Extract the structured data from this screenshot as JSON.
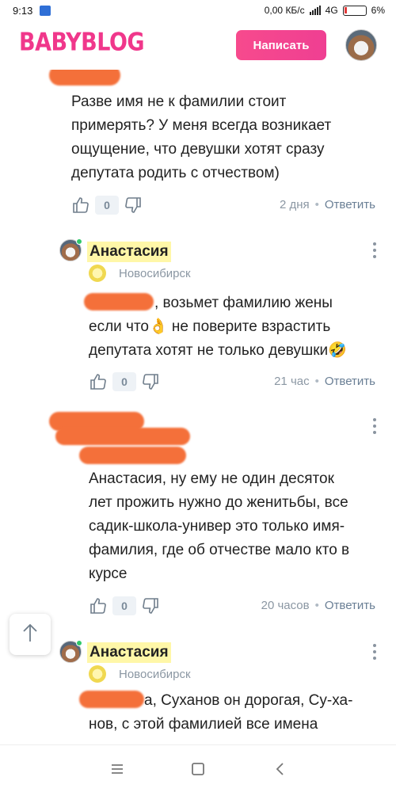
{
  "statusbar": {
    "time": "9:13",
    "network_speed": "0,00 КБ/с",
    "network_type": "4G",
    "battery": "6%"
  },
  "header": {
    "logo": "BABYBLOG",
    "write_button": "Написать"
  },
  "comments": [
    {
      "text_lines": [
        "Разве имя не к фамилии стоит",
        "примерять? У меня всегда возникает",
        "ощущение, что девушки хотят сразу",
        "депутата родить с отчеством)"
      ],
      "likes": "0",
      "time": "2 дня",
      "reply": "Ответить"
    },
    {
      "author": "Анастасия",
      "city": "Новосибирск",
      "text_lines": [
        ", возьмет фамилию жены",
        "если что👌 не поверите взрастить",
        "депутата хотят не только девушки🤣"
      ],
      "likes": "0",
      "time": "21 час",
      "reply": "Ответить"
    },
    {
      "text_lines": [
        "Анастасия, ну ему не один десяток",
        "лет прожить нужно до женитьбы, все",
        "садик-школа-универ это только имя-",
        "фамилия, где об отчестве мало кто в",
        "курсе"
      ],
      "likes": "0",
      "time": "20 часов",
      "reply": "Ответить"
    },
    {
      "author": "Анастасия",
      "city": "Новосибирск",
      "text_lines": [
        "а, Суханов он дорогая, Су-ха-",
        "нов, с этой фамилией все имена"
      ]
    }
  ],
  "colors": {
    "brand": "#f0378b",
    "redaction": "#f4703a",
    "highlight": "#fff7a8",
    "online": "#2fc86a"
  },
  "icons": [
    "thumbs-up-icon",
    "thumbs-down-icon",
    "kebab-icon",
    "location-icon",
    "arrow-up-icon",
    "menu-icon",
    "home-icon",
    "back-icon"
  ]
}
